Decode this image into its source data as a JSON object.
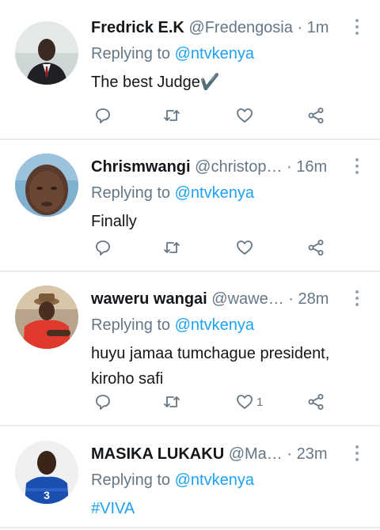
{
  "tweets": [
    {
      "name": "Fredrick E.K",
      "handle": "@Fredengosia",
      "time": "1m",
      "replying_prefix": "Replying to",
      "replying_to": "@ntvkenya",
      "text": "The best Judge✔️",
      "likes": ""
    },
    {
      "name": "Chrismwangi",
      "handle": "@christop…",
      "time": "16m",
      "replying_prefix": "Replying to",
      "replying_to": "@ntvkenya",
      "text": "Finally",
      "likes": ""
    },
    {
      "name": "waweru wangai",
      "handle": "@wawe…",
      "time": "28m",
      "replying_prefix": "Replying to",
      "replying_to": "@ntvkenya",
      "text": "huyu jamaa tumchague president, kiroho safi",
      "likes": "1"
    },
    {
      "name": "MASIKA LUKAKU",
      "handle": "@Ma…",
      "time": "23m",
      "replying_prefix": "Replying to",
      "replying_to": "@ntvkenya",
      "text": "#VIVA",
      "likes": ""
    }
  ],
  "separator": "·",
  "icons": [
    "reply-icon",
    "retweet-icon",
    "like-icon",
    "share-icon",
    "more-options-icon"
  ],
  "colors": {
    "link": "#1da1f2",
    "secondary": "#657786",
    "divider": "#e6ecf0"
  }
}
